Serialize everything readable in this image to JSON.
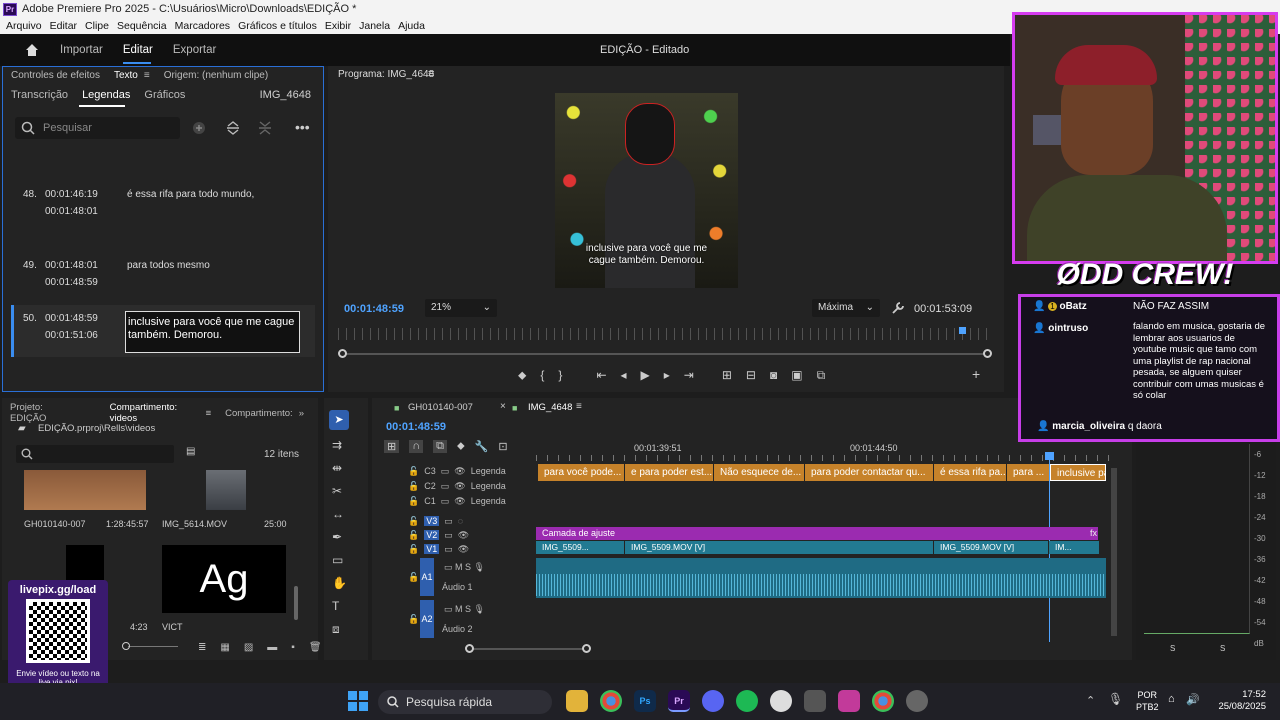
{
  "window": {
    "title": "Adobe Premiere Pro 2025 - C:\\Usuários\\Micro\\Downloads\\EDIÇÃO *",
    "app_badge": "Pr"
  },
  "menu": [
    "Arquivo",
    "Editar",
    "Clipe",
    "Sequência",
    "Marcadores",
    "Gráficos e títulos",
    "Exibir",
    "Janela",
    "Ajuda"
  ],
  "header": {
    "workspaces": [
      "Importar",
      "Editar",
      "Exportar"
    ],
    "active": "Editar",
    "doc_title": "EDIÇÃO - Editado"
  },
  "left_panel": {
    "tabs": [
      "Controles de efeitos",
      "Texto",
      "Origem: (nenhum clipe)"
    ],
    "subtabs": [
      "Transcrição",
      "Legendas",
      "Gráficos"
    ],
    "clip_name": "IMG_4648",
    "search_placeholder": "Pesquisar",
    "captions": [
      {
        "num": "48.",
        "start": "00:01:46:19",
        "end": "00:01:48:01",
        "text": "é essa rifa para todo mundo,"
      },
      {
        "num": "49.",
        "start": "00:01:48:01",
        "end": "00:01:48:59",
        "text": "para todos mesmo"
      },
      {
        "num": "50.",
        "start": "00:01:48:59",
        "end": "00:01:51:06",
        "text": "inclusive para você que me cague também. Demorou."
      }
    ]
  },
  "program": {
    "title": "Programa: IMG_4648",
    "timecode": "00:01:48:59",
    "zoom": "21%",
    "quality": "Máxima",
    "duration": "00:01:53:09",
    "subtitle": "inclusive para você que me cague também. Demorou."
  },
  "project": {
    "tabs": [
      "Projeto: EDIÇÃO",
      "Compartimento: videos",
      "Compartimento:"
    ],
    "path": "EDIÇÃO.prproj\\Rells\\videos",
    "count": "12 itens",
    "items": [
      {
        "name": "GH010140-007",
        "duration": "1:28:45:57"
      },
      {
        "name": "IMG_5614.MOV",
        "duration": "25:00"
      },
      {
        "name": "",
        "duration": "4:23"
      },
      {
        "name": "VICT",
        "duration": ""
      }
    ],
    "ag_label": "Ag"
  },
  "livepix": {
    "title": "livepix.gg/load",
    "caption": "Envie vídeo ou texto na live via pix!"
  },
  "timeline": {
    "tabs": [
      "GH010140-007",
      "IMG_4648"
    ],
    "timecode": "00:01:48:59",
    "ruler": [
      "00:01:39:51",
      "00:01:44:50"
    ],
    "tracks": {
      "captions": [
        "C3",
        "C2",
        "C1"
      ],
      "caption_label": "Legenda",
      "video": [
        "V3",
        "V2",
        "V1"
      ],
      "audio": [
        {
          "id": "A1",
          "name": "Áudio 1"
        },
        {
          "id": "A2",
          "name": "Áudio 2"
        }
      ]
    },
    "caption_clips": [
      "para você pode...",
      "e para poder est...",
      "Não esquece de...",
      "para poder contactar qu...",
      "é essa rifa pa...",
      "para ...",
      "inclusive pa"
    ],
    "adjust_layer": "Camada de ajuste",
    "video_clips": [
      "IMG_5509...",
      "IMG_5509.MOV [V]",
      "IMG_5509.MOV [V]",
      "IM..."
    ]
  },
  "meter": {
    "ticks": [
      "-6",
      "-12",
      "-18",
      "-24",
      "-30",
      "-36",
      "-42",
      "-48",
      "-54",
      "dB"
    ],
    "footer": [
      "S",
      "S"
    ]
  },
  "stream": {
    "brand": "ØDD CREW!",
    "chat": [
      {
        "user": "oBatz",
        "msg": "NÃO FAZ ASSIM"
      },
      {
        "user": "ointruso",
        "msg": "falando em musica, gostaria de lembrar aos usuarios de youtube music que tamo com uma playlist de rap nacional pesada, se alguem quiser contribuir com umas musicas é só colar"
      },
      {
        "user": "marcia_oliveira",
        "msg": "q daora"
      }
    ]
  },
  "taskbar": {
    "search": "Pesquisa rápida",
    "lang": "POR",
    "layout": "PTB2",
    "time": "17:52",
    "date": "25/08/2025"
  }
}
